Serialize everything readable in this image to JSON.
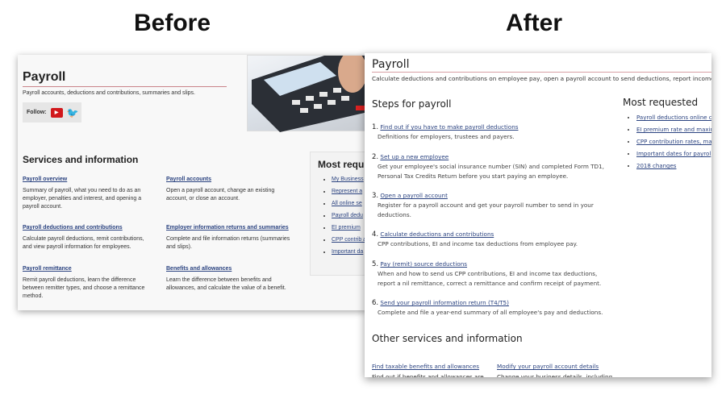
{
  "labels": {
    "before": "Before",
    "after": "After"
  },
  "before": {
    "title": "Payroll",
    "subtitle": "Payroll accounts, deductions and contributions, summaries and slips.",
    "follow": "Follow:",
    "services_heading": "Services and information",
    "services": [
      {
        "link": "Payroll overview",
        "desc": "Summary of payroll, what you need to do as an employer, penalties and interest, and opening a payroll account."
      },
      {
        "link": "Payroll accounts",
        "desc": "Open a payroll account, change an existing account, or close an account."
      },
      {
        "link": "Payroll deductions and contributions",
        "desc": "Calculate payroll deductions, remit contributions, and view payroll information for employees."
      },
      {
        "link": "Employer information returns and summaries",
        "desc": "Complete and file information returns (summaries and slips)."
      },
      {
        "link": "Payroll remittance",
        "desc": "Remit payroll deductions, learn the difference between remitter types, and choose a remittance method."
      },
      {
        "link": "Benefits and allowances",
        "desc": "Learn the difference between benefits and allowances, and calculate the value of a benefit."
      }
    ],
    "most_requested_heading": "Most requ",
    "most_requested": [
      "My Business",
      "Represent a",
      "All online se",
      "Payroll dedu",
      "EI premium",
      "CPP contrib and exempti",
      "Important da"
    ]
  },
  "after": {
    "title": "Payroll",
    "subtitle": "Calculate deductions and contributions on employee pay, open a payroll account to send deductions, report income dec",
    "steps_heading": "Steps for payroll",
    "steps": [
      {
        "num": "1.",
        "link": "Find out if you have to make payroll deductions",
        "desc": "Definitions for employers, trustees and payers."
      },
      {
        "num": "2.",
        "link": "Set up a new employee",
        "desc": "Get your employee's social insurance number (SIN) and completed Form TD1, Personal Tax Credits Return before you start paying an employee."
      },
      {
        "num": "3.",
        "link": "Open a payroll account",
        "desc": "Register for a payroll account and get your payroll number to send in your deductions."
      },
      {
        "num": "4.",
        "link": "Calculate deductions and contributions",
        "desc": "CPP contributions, EI and income tax deductions from employee pay."
      },
      {
        "num": "5.",
        "link": "Pay (remit) source deductions",
        "desc": "When and how to send us CPP contributions, EI and income tax deductions, report a nil remittance, correct a remittance and confirm receipt of payment."
      },
      {
        "num": "6.",
        "link": "Send your payroll information return (T4/T5)",
        "desc": "Complete and file a year-end summary of all employee's pay and deductions."
      }
    ],
    "most_requested_heading": "Most requested",
    "most_requested": [
      "Payroll deductions online c",
      "EI premium rate and maxir",
      "CPP contribution rates, ma and exemptions",
      "Important dates for payrol",
      "2018 changes"
    ],
    "other_heading": "Other services and information",
    "other": [
      {
        "link": "Find taxable benefits and allowances",
        "desc": "Find out if benefits and allowances are"
      },
      {
        "link": "Modify your payroll account details",
        "desc": "Change your business details, including"
      }
    ]
  }
}
